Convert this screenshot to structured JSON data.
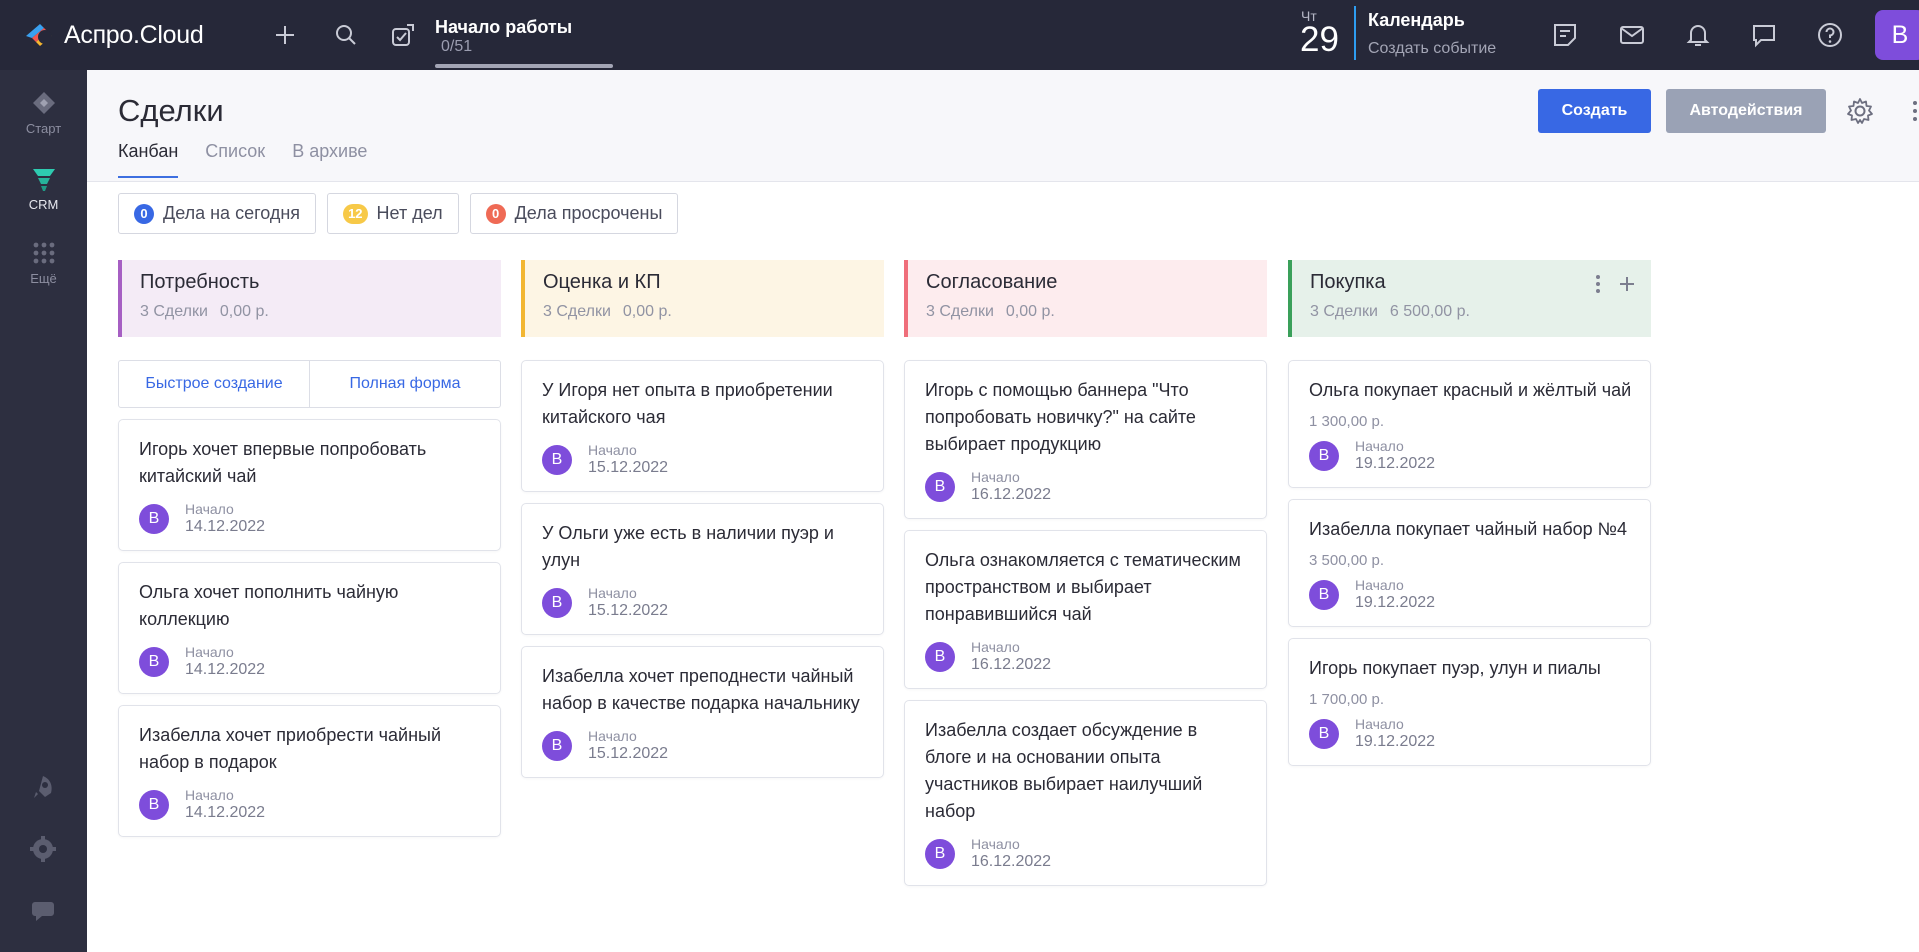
{
  "topbar": {
    "logo_text": "Аспро.Cloud",
    "onboarding_title": "Начало работы",
    "onboarding_count": "0/51",
    "onboarding_progress": 0.0,
    "calendar_day_abbr": "Чт",
    "calendar_day_num": "29",
    "calendar_title": "Календарь",
    "calendar_sub": "Создать событие",
    "user_initial": "B",
    "icons": [
      "plus-icon",
      "search-icon",
      "onboarding-icon",
      "notes-icon",
      "mail-icon",
      "bell-icon",
      "chat-icon",
      "help-icon"
    ]
  },
  "rail": {
    "items": [
      {
        "label": "Старт",
        "icon": "start-icon"
      },
      {
        "label": "CRM",
        "icon": "crm-funnel-icon"
      },
      {
        "label": "Ещё",
        "icon": "apps-grid-icon"
      }
    ],
    "bottom_icons": [
      "rocket-icon",
      "settings-icon",
      "support-chat-icon"
    ]
  },
  "header": {
    "title": "Сделки",
    "tabs": [
      "Канбан",
      "Список",
      "В архиве"
    ],
    "active_tab": "Канбан",
    "create_label": "Создать",
    "auto_label": "Автодействия"
  },
  "filters": [
    {
      "count": "0",
      "label": "Дела на сегодня",
      "color": "#3868e4"
    },
    {
      "count": "12",
      "label": "Нет дел",
      "color": "#f7c948"
    },
    {
      "count": "0",
      "label": "Дела просрочены",
      "color": "#ef6a55"
    }
  ],
  "colors": {
    "topbar": "#262839",
    "rail": "#2d2f40",
    "accent": "#3868e4",
    "avatar": "#7e4ddb"
  },
  "columns": [
    {
      "title": "Потребность",
      "deals": "3 Сделки",
      "sum": "0,00 р.",
      "color": "#a65fc3",
      "bg": "#f4ebf6",
      "quick_create": "Быстрое создание",
      "full_form": "Полная форма",
      "cards": [
        {
          "title": "Игорь хочет впервые попробовать китайский чай",
          "stage": "Начало",
          "date": "14.12.2022",
          "avatar": "B"
        },
        {
          "title": "Ольга хочет пополнить чайную коллекцию",
          "stage": "Начало",
          "date": "14.12.2022",
          "avatar": "B"
        },
        {
          "title": "Изабелла хочет приобрести чайный набор в подарок",
          "stage": "Начало",
          "date": "14.12.2022",
          "avatar": "B"
        }
      ]
    },
    {
      "title": "Оценка и КП",
      "deals": "3 Сделки",
      "sum": "0,00 р.",
      "color": "#f2b632",
      "bg": "#fdf5e4",
      "cards": [
        {
          "title": "У Игоря нет опыта в приобретении китайского чая",
          "stage": "Начало",
          "date": "15.12.2022",
          "avatar": "B"
        },
        {
          "title": "У Ольги уже есть в наличии пуэр и улун",
          "stage": "Начало",
          "date": "15.12.2022",
          "avatar": "B"
        },
        {
          "title": "Изабелла хочет преподнести чайный набор в качестве подарка начальнику",
          "stage": "Начало",
          "date": "15.12.2022",
          "avatar": "B"
        }
      ]
    },
    {
      "title": "Согласование",
      "deals": "3 Сделки",
      "sum": "0,00 р.",
      "color": "#ef6e7a",
      "bg": "#fdecee",
      "cards": [
        {
          "title": "Игорь с помощью баннера \"Что попробовать новичку?\" на сайте выбирает продукцию",
          "stage": "Начало",
          "date": "16.12.2022",
          "avatar": "B"
        },
        {
          "title": "Ольга ознакомляется с тематическим пространством и выбирает понравившийся чай",
          "stage": "Начало",
          "date": "16.12.2022",
          "avatar": "B"
        },
        {
          "title": "Изабелла создает обсуждение в блоге и на основании опыта участников выбирает наилучший набор",
          "stage": "Начало",
          "date": "16.12.2022",
          "avatar": "B"
        }
      ]
    },
    {
      "title": "Покупка",
      "deals": "3 Сделки",
      "sum": "6 500,00 р.",
      "color": "#3aa05a",
      "bg": "#e6f1ea",
      "cards": [
        {
          "title": "Ольга покупает красный и жёлтый чай",
          "price": "1 300,00 р.",
          "stage": "Начало",
          "date": "19.12.2022",
          "avatar": "B"
        },
        {
          "title": "Изабелла покупает чайный набор №4",
          "price": "3 500,00 р.",
          "stage": "Начало",
          "date": "19.12.2022",
          "avatar": "B"
        },
        {
          "title": "Игорь покупает пуэр, улун и пиалы",
          "price": "1 700,00 р.",
          "stage": "Начало",
          "date": "19.12.2022",
          "avatar": "B"
        }
      ]
    }
  ]
}
